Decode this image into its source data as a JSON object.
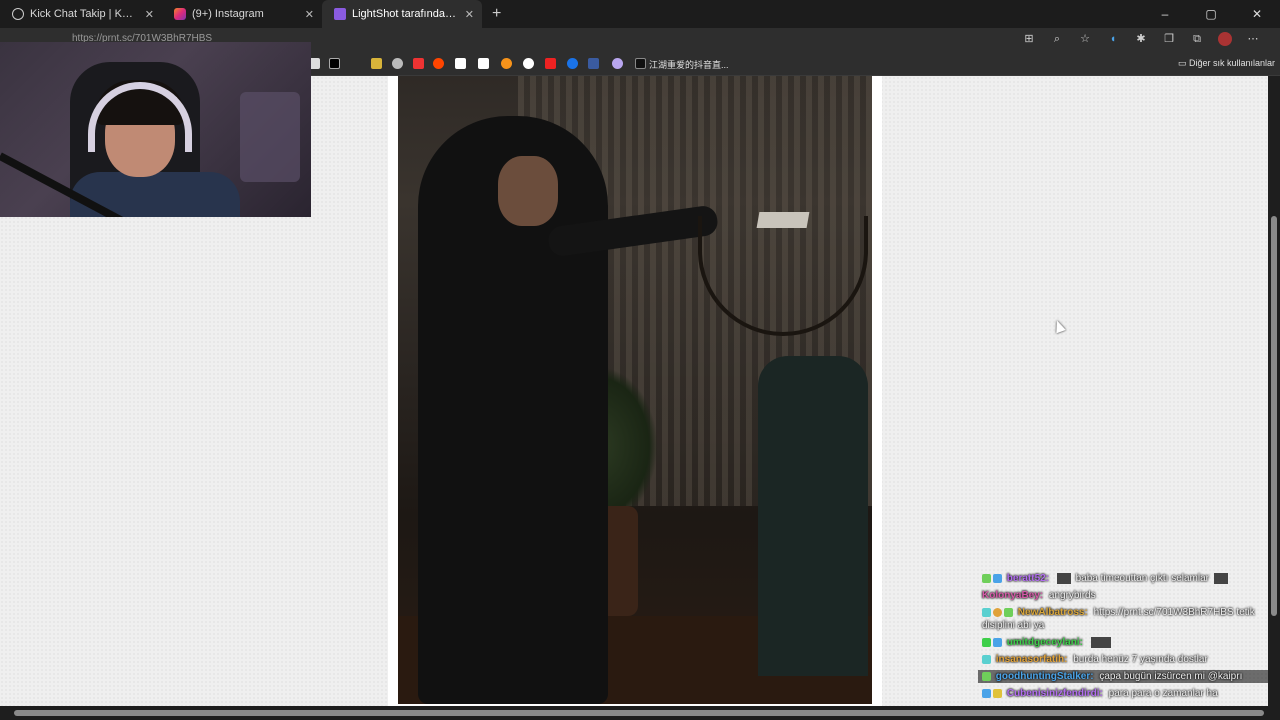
{
  "browser": {
    "tabs": [
      {
        "label": "Kick Chat Takip | KokoWich",
        "icon": "globe-icon",
        "active": false
      },
      {
        "label": "(9+) Instagram",
        "icon": "instagram-icon",
        "active": false
      },
      {
        "label": "LightShot tarafından Ekran Görünt",
        "icon": "lightshot-icon",
        "active": true
      }
    ],
    "new_tab": "+",
    "url": "https://prnt.sc/701W3BhR7HBS",
    "bookmark_text": "江湖重爱的抖音直...",
    "other_bookmarks": "Diğer sık kullanılanlar",
    "window_controls": [
      "–",
      "▢",
      "✕"
    ]
  },
  "chat": {
    "messages": [
      {
        "user": "beratt52:",
        "user_color": "#b26df0",
        "text": "baba timeouttan çıktı selamlar"
      },
      {
        "user": "KolonyaBey:",
        "user_color": "#d65aa8",
        "text": "angrybirds"
      },
      {
        "user": "NewAlbatross:",
        "user_color": "#d9a63a",
        "text": "https://prnt.sc/701W3BhR7HBS tetik disiplini abi ya"
      },
      {
        "user": "umitdgeceylani:",
        "user_color": "#3ecf4a",
        "text": ""
      },
      {
        "user": "insanasorfatih:",
        "user_color": "#e0a23a",
        "text": "burda henüz 7 yaşında dostlar"
      },
      {
        "user": "goodhuntingStalker:",
        "user_color": "#4aa3e8",
        "text": "çapa bugün izsürcen mi @kaiprı"
      },
      {
        "user": "Cubenisinizfendirdi:",
        "user_color": "#b26df0",
        "text": "para para o zamanlar ha"
      }
    ]
  },
  "colors": {
    "page_bg": "#efefef",
    "tab_bar": "#1c1c1c",
    "active_tab": "#2e2e2e"
  }
}
